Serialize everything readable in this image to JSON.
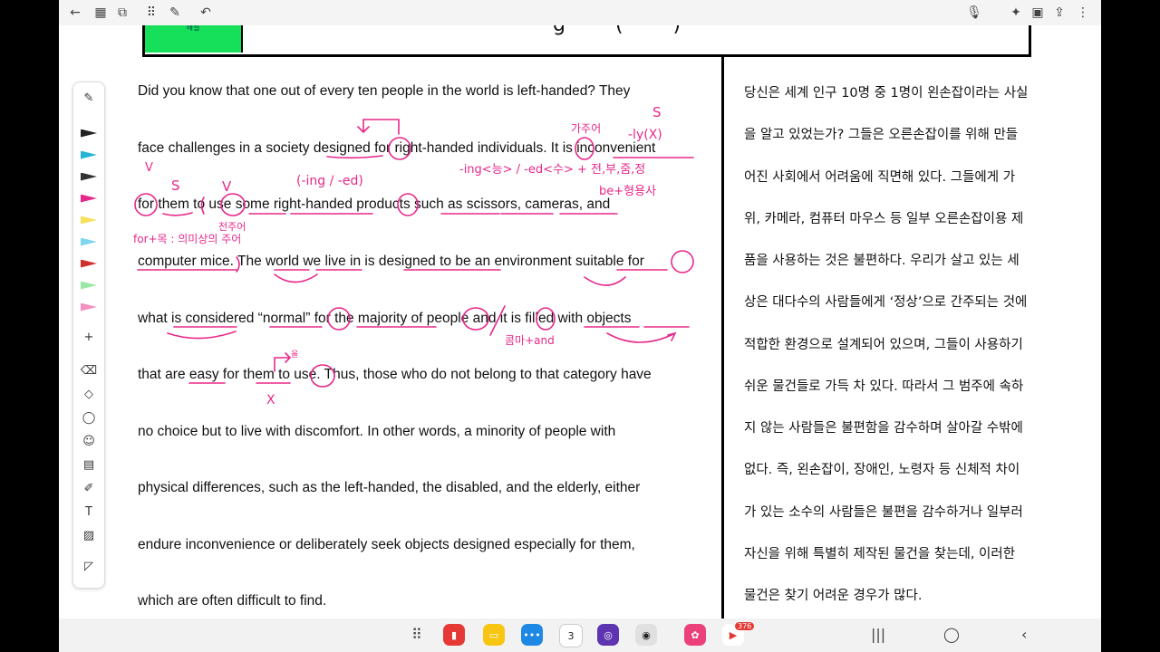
{
  "header": {
    "green_label": "해설",
    "title_fragment": "g  (  )  "
  },
  "english_lines": [
    "Did you know that one out of every ten people in the world is left-handed? They",
    "face challenges in a society designed for right-handed individuals. It is inconvenient",
    "for them to use some right-handed products such as scissors, cameras, and",
    "computer mice. The world we live in is designed to be an environment suitable for",
    "what is considered “normal” for the majority of people and it is filled with objects",
    "that are easy for them to use. Thus, those who do not belong to that category have",
    "no choice but to live with discomfort. In other words, a minority of people with",
    "physical differences, such as the left-handed, the disabled, and the elderly, either",
    "endure inconvenience or deliberately seek objects designed especially for them,",
    "which are often difficult to find."
  ],
  "korean_lines": [
    "당신은 세계 인구 10명 중 1명이 왼손잡이라는 사실",
    "을 알고 있었는가? 그들은 오른손잡이를 위해 만들",
    "어진 사회에서 어려움에 직면해 있다. 그들에게 가",
    "위, 카메라, 컴퓨터 마우스 등 일부 오른손잡이용 제",
    "품을 사용하는 것은 불편하다. 우리가 살고 있는 세",
    "상은 대다수의 사람들에게 ‘정상’으로 간주되는 것에",
    "적합한 환경으로 설계되어 있으며, 그들이 사용하기",
    "쉬운 물건들로 가득 차 있다. 따라서 그 범주에 속하",
    "지 않는 사람들은 불편함을 감수하며 살아갈 수밖에",
    "없다. 즉, 왼손잡이, 장애인, 노령자 등 신체적 차이",
    "가 있는 소수의 사람들은 불편을 감수하거나 일부러",
    "자신을 위해 특별히 제작된 물건을 찾는데, 이러한",
    "물건은 찾기 어려운 경우가 많다."
  ],
  "annotations": {
    "gajueo": "가주어",
    "s1": "S",
    "ly": "-ly(X)",
    "ing_ed": "(-ing / -ed)",
    "ing_rule": "-ing<능> / -ed<수> + 전,부,줌,정",
    "be_adj": "be+형용사",
    "v_mark": "V",
    "s2": "S",
    "v2": "V",
    "jeonju": "전주어",
    "for_mok": "for+목 : 의미상의 주어",
    "kuma": "콤마+and",
    "eul": "을",
    "x_mark": "X"
  },
  "navbar": {
    "calendar_day": "3",
    "youtube_badge": "376"
  },
  "colors": {
    "ink": "#e8288a",
    "green": "#16e05a"
  }
}
